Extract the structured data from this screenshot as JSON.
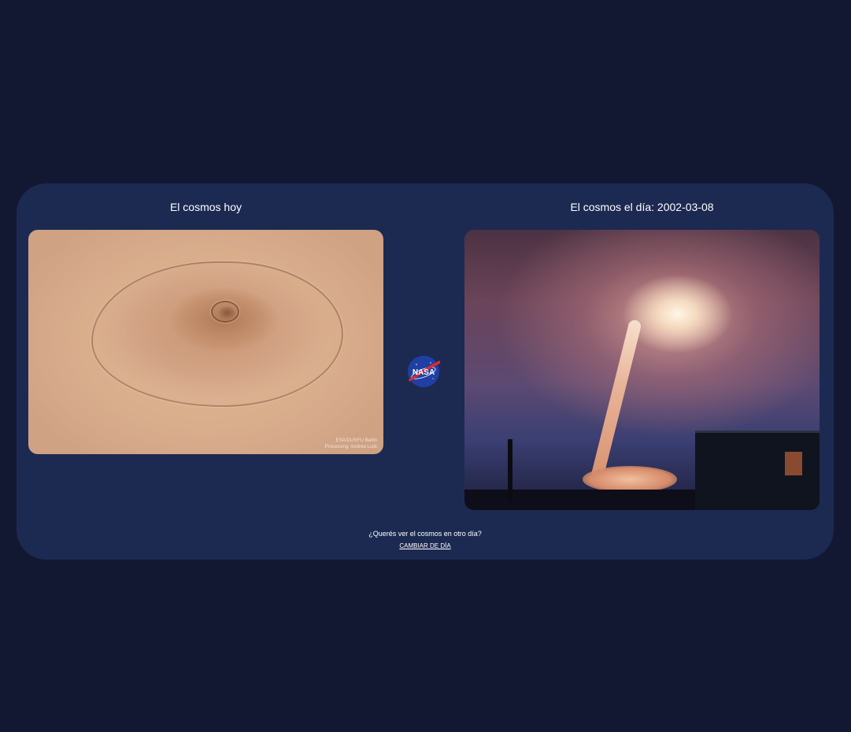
{
  "panels": {
    "today": {
      "title": "El cosmos hoy",
      "image_credit_line1": "ESA/DLR/FU Berlin",
      "image_credit_line2": "Processing: Andrea Luck"
    },
    "other_day": {
      "title": "El cosmos el día: 2002-03-08"
    }
  },
  "logo": {
    "label": "NASA",
    "icon": "nasa-meatball-icon"
  },
  "footer": {
    "question": "¿Querés ver el cosmos en otro día?",
    "change_link": "CAMBIAR DE DÍA"
  },
  "colors": {
    "page_background": "#131832",
    "card_background": "#1c2a52",
    "text": "#ffffff"
  }
}
